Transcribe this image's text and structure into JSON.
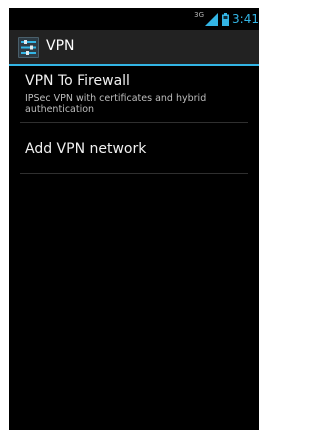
{
  "status_bar": {
    "network_type": "3G",
    "time": "3:41",
    "icons": [
      "signal-icon",
      "battery-icon"
    ]
  },
  "action_bar": {
    "title": "VPN",
    "icon": "vpn-settings-icon"
  },
  "vpn_list": {
    "items": [
      {
        "title": "VPN To Firewall",
        "summary": "IPSec VPN with certificates and hybrid authentication"
      },
      {
        "title": "Add VPN network"
      }
    ]
  },
  "colors": {
    "accent": "#33b5e5",
    "background": "#000000",
    "action_bar": "#222222"
  }
}
